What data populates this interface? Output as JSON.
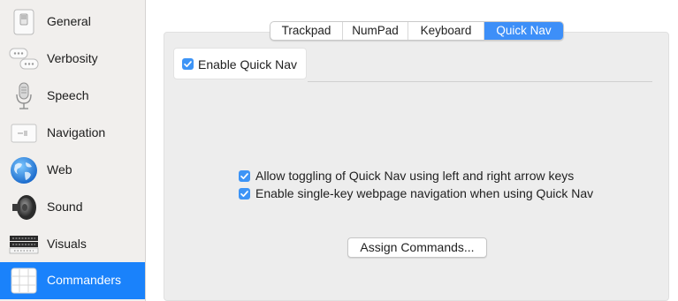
{
  "sidebar": {
    "items": [
      {
        "label": "General",
        "icon": "general-switch-icon"
      },
      {
        "label": "Verbosity",
        "icon": "speech-bubbles-icon"
      },
      {
        "label": "Speech",
        "icon": "microphone-icon"
      },
      {
        "label": "Navigation",
        "icon": "navigation-icon"
      },
      {
        "label": "Web",
        "icon": "globe-icon"
      },
      {
        "label": "Sound",
        "icon": "speaker-icon"
      },
      {
        "label": "Visuals",
        "icon": "braille-panel-icon"
      },
      {
        "label": "Commanders",
        "icon": "grid-icon"
      }
    ],
    "selected": "Commanders"
  },
  "tabs": [
    {
      "label": "Trackpad"
    },
    {
      "label": "NumPad"
    },
    {
      "label": "Keyboard"
    },
    {
      "label": "Quick Nav"
    }
  ],
  "active_tab": "Quick Nav",
  "quick_nav": {
    "enable_label": "Enable Quick Nav",
    "enable_checked": true,
    "options": [
      {
        "label": "Allow toggling of Quick Nav using left and right arrow keys",
        "checked": true
      },
      {
        "label": "Enable single-key webpage navigation when using Quick Nav",
        "checked": true
      }
    ],
    "assign_button": "Assign Commands..."
  },
  "colors": {
    "accent": "#1a82fb",
    "checkbox": "#3d94f6",
    "sidebar_bg": "#f1efed",
    "panel_bg": "#ededed"
  }
}
